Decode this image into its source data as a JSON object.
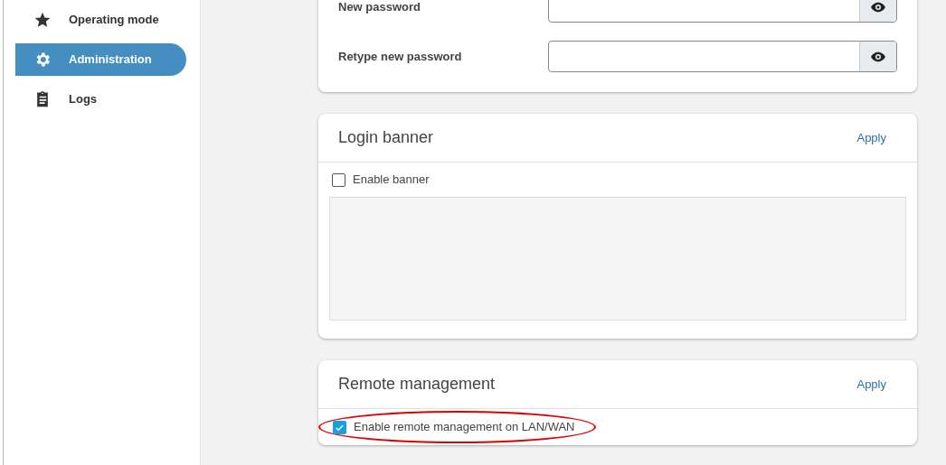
{
  "sidebar": {
    "items": [
      {
        "label": "Operating mode",
        "kind": "star",
        "selected": false
      },
      {
        "label": "Administration",
        "kind": "gear",
        "selected": true
      },
      {
        "label": "Logs",
        "kind": "clipboard",
        "selected": false
      }
    ]
  },
  "password_card": {
    "fields": [
      {
        "label": "New password"
      },
      {
        "label": "Retype new password"
      }
    ]
  },
  "login_banner": {
    "title": "Login banner",
    "action": "Apply",
    "checkbox": {
      "label": "Enable banner",
      "checked": false
    }
  },
  "remote_management": {
    "title": "Remote management",
    "action": "Apply",
    "checkbox": {
      "label": "Enable remote management on LAN/WAN",
      "checked": true
    },
    "highlighted": true
  }
}
